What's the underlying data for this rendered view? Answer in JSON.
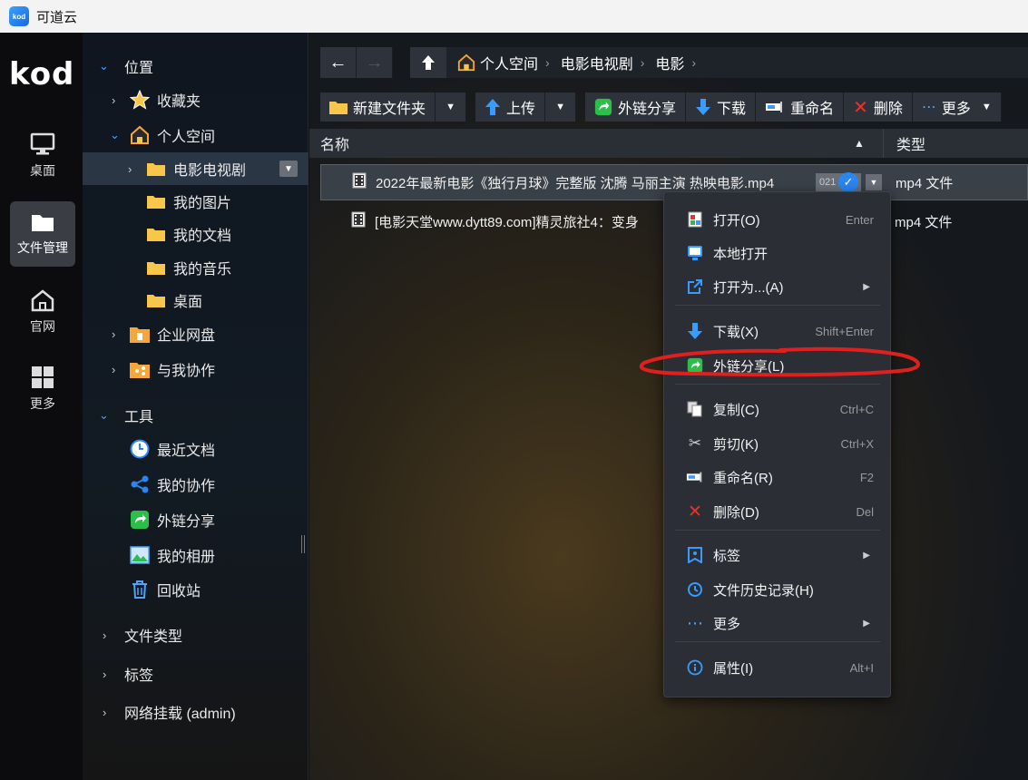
{
  "window": {
    "title": "可道云",
    "logo_text": "kod"
  },
  "rail": {
    "brand": "kod",
    "items": [
      {
        "label": "桌面"
      },
      {
        "label": "文件管理"
      },
      {
        "label": "官网"
      },
      {
        "label": "更多"
      }
    ]
  },
  "sidebar": {
    "section_location": "位置",
    "favorites": "收藏夹",
    "personal_space": "个人空间",
    "folders": [
      "电影电视剧",
      "我的图片",
      "我的文档",
      "我的音乐",
      "桌面"
    ],
    "enterprise": "企业网盘",
    "collab_with_me": "与我协作",
    "section_tools": "工具",
    "tools": [
      "最近文档",
      "我的协作",
      "外链分享",
      "我的相册",
      "回收站"
    ],
    "file_types": "文件类型",
    "tags": "标签",
    "mounts": "网络挂载 (admin)"
  },
  "breadcrumb": [
    "个人空间",
    "电影电视剧",
    "电影"
  ],
  "toolbar": {
    "new_folder": "新建文件夹",
    "upload": "上传",
    "share": "外链分享",
    "download": "下载",
    "rename": "重命名",
    "delete": "删除",
    "more": "更多"
  },
  "list": {
    "col_name": "名称",
    "col_type": "类型",
    "files": [
      {
        "name": "2022年最新电影《独行月球》完整版 沈腾 马丽主演 热映电影.mp4",
        "type": "mp4 文件",
        "badge": "021"
      },
      {
        "name": "[电影天堂www.dytt89.com]精灵旅社4：变身",
        "type": "mp4 文件"
      }
    ]
  },
  "context_menu": {
    "items": [
      {
        "label": "打开(O)",
        "shortcut": "Enter"
      },
      {
        "label": "本地打开",
        "shortcut": ""
      },
      {
        "label": "打开为...(A)",
        "shortcut": ""
      },
      {
        "label": "下载(X)",
        "shortcut": "Shift+Enter"
      },
      {
        "label": "外链分享(L)",
        "shortcut": ""
      },
      {
        "label": "复制(C)",
        "shortcut": "Ctrl+C"
      },
      {
        "label": "剪切(K)",
        "shortcut": "Ctrl+X"
      },
      {
        "label": "重命名(R)",
        "shortcut": "F2"
      },
      {
        "label": "删除(D)",
        "shortcut": "Del"
      },
      {
        "label": "标签",
        "shortcut": ""
      },
      {
        "label": "文件历史记录(H)",
        "shortcut": ""
      },
      {
        "label": "更多",
        "shortcut": ""
      },
      {
        "label": "属性(I)",
        "shortcut": "Alt+I"
      }
    ]
  },
  "colors": {
    "accent": "#2b86f0",
    "annotation": "#e0201e",
    "folder": "#f7c64a"
  }
}
